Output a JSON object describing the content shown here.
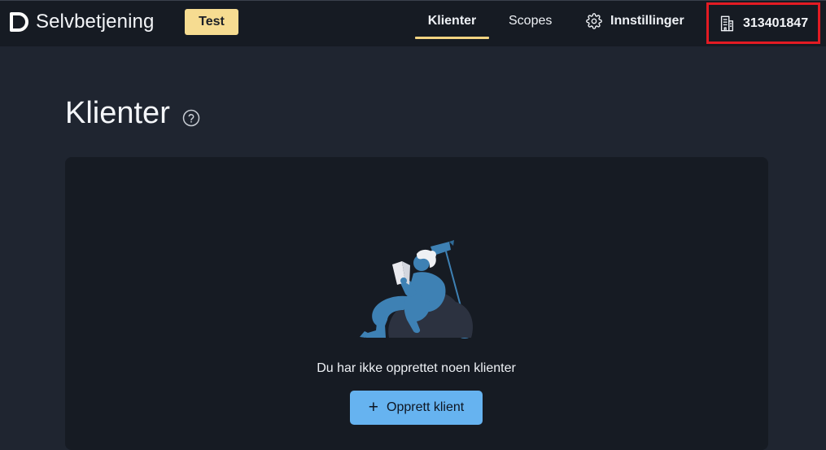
{
  "header": {
    "brand_name": "Selvbetjening",
    "logo_icon": "selvbetjening-logo-icon",
    "env_badge": "Test",
    "nav": [
      {
        "label": "Klienter",
        "active": true
      },
      {
        "label": "Scopes",
        "active": false
      },
      {
        "label": "Innstillinger",
        "icon": "gear-icon",
        "active": false
      }
    ],
    "organization": {
      "label": "313401847",
      "icon": "building-icon",
      "highlight_color": "#e31b23"
    }
  },
  "main": {
    "title": "Klienter",
    "help_icon": "question-circle-icon",
    "empty_state": {
      "illustration": "person-reading-in-chair-illustration",
      "message": "Du har ikke opprettet noen klienter",
      "button_label": "Opprett klient",
      "button_icon": "plus-icon"
    }
  },
  "colors": {
    "background": "#1f2530",
    "header_bg": "#161b23",
    "badge": "#f6dc91",
    "active_underline": "#f3d481",
    "primary_button": "#66b3f0"
  }
}
